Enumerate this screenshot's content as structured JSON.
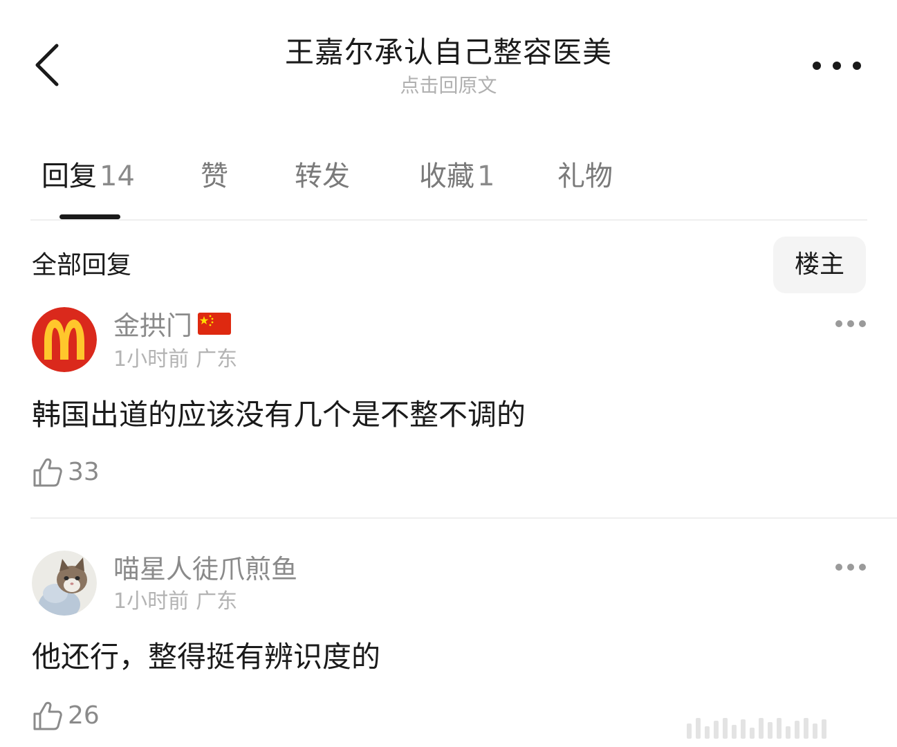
{
  "header": {
    "title": "王嘉尔承认自己整容医美",
    "subtitle": "点击回原文",
    "back_icon": "chevron-left-icon",
    "more_icon": "more-horizontal-icon"
  },
  "tabs": [
    {
      "label": "回复",
      "count": "14",
      "active": true
    },
    {
      "label": "赞",
      "count": ""
    },
    {
      "label": "转发",
      "count": ""
    },
    {
      "label": "收藏",
      "count": "1"
    },
    {
      "label": "礼物",
      "count": ""
    }
  ],
  "section": {
    "title": "全部回复",
    "filter_label": "楼主"
  },
  "comments": [
    {
      "username": "金拱门",
      "flag": "china-flag",
      "time": "1小时前",
      "location": "广东",
      "text": "韩国出道的应该没有几个是不整不调的",
      "likes": "33",
      "avatar": "mcdonalds-logo"
    },
    {
      "username": "喵星人徒爪煎鱼",
      "time": "1小时前",
      "location": "广东",
      "text": "他还行，整得挺有辨识度的",
      "likes": "26",
      "avatar": "cat-photo"
    }
  ],
  "colors": {
    "text_primary": "#1a1a1a",
    "text_secondary": "#8a8a8a",
    "text_muted": "#b3b3b3",
    "mcdonalds_red": "#da291c",
    "mcdonalds_yellow": "#ffc72c",
    "divider": "#efefef",
    "filter_bg": "#f4f4f4"
  }
}
